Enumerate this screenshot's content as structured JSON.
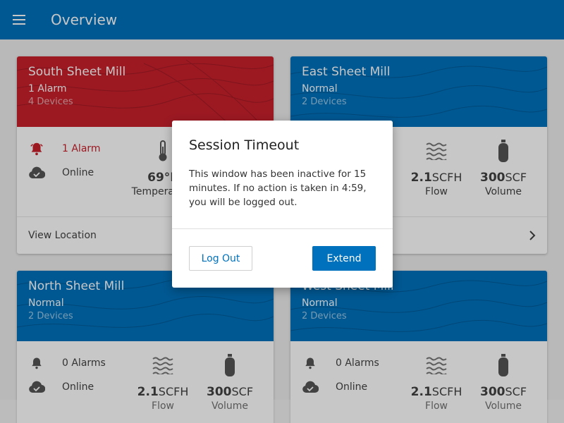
{
  "appbar": {
    "title": "Overview"
  },
  "cards": [
    {
      "title": "South Sheet Mill",
      "status": "1 Alarm",
      "devices": "4 Devices",
      "alarm_text": "1 Alarm",
      "connection": "Online",
      "temp_value": "69°F",
      "temp_label": "Temperature",
      "footer": "View Location"
    },
    {
      "title": "East Sheet Mill",
      "status": "Normal",
      "devices": "2 Devices",
      "flow_value": "2.1",
      "flow_unit": "SCFH",
      "flow_label": "Flow",
      "volume_value": "300",
      "volume_unit": "SCF",
      "volume_label": "Volume"
    },
    {
      "title": "North Sheet Mill",
      "status": "Normal",
      "devices": "2 Devices",
      "alarm_text": "0 Alarms",
      "connection": "Online",
      "flow_value": "2.1",
      "flow_unit": "SCFH",
      "flow_label": "Flow",
      "volume_value": "300",
      "volume_unit": "SCF",
      "volume_label": "Volume"
    },
    {
      "title": "West Sheet Mill",
      "status": "Normal",
      "devices": "2 Devices",
      "alarm_text": "0 Alarms",
      "connection": "Online",
      "flow_value": "2.1",
      "flow_unit": "SCFH",
      "flow_label": "Flow",
      "volume_value": "300",
      "volume_unit": "SCF",
      "volume_label": "Volume"
    }
  ],
  "dialog": {
    "title": "Session Timeout",
    "message": "This window has been inactive for 15 minutes. If no action is taken in 4:59, you will be logged out.",
    "logout_label": "Log Out",
    "extend_label": "Extend"
  },
  "colors": {
    "primary": "#0071bc",
    "alarm": "#c8202c"
  }
}
